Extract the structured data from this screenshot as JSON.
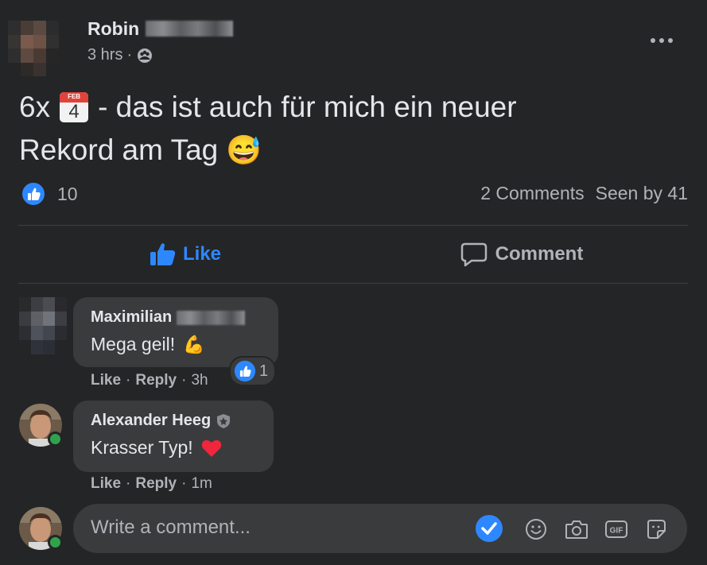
{
  "post": {
    "author_first": "Robin",
    "time": "3 hrs",
    "privacy_sep": "·",
    "text_line1_prefix": "6x",
    "calendar_month": "FEB",
    "calendar_day": "4",
    "text_line1_suffix": "- das ist auch für mich ein neuer",
    "text_line2": "Rekord am Tag",
    "emoji": "😅",
    "reaction_count": "10",
    "comments_count": "2 Comments",
    "seen_by": "Seen by 41"
  },
  "actions": {
    "like_label": "Like",
    "comment_label": "Comment"
  },
  "comments": [
    {
      "author": "Maximilian",
      "text": "Mega geil!",
      "emoji": "💪",
      "like": "Like",
      "reply": "Reply",
      "time": "3h",
      "reaction_count": "1"
    },
    {
      "author": "Alexander Heeg",
      "text": "Krasser Typ!",
      "emoji": "❤️",
      "like": "Like",
      "reply": "Reply",
      "time": "1m"
    }
  ],
  "composer": {
    "placeholder": "Write a comment..."
  },
  "colors": {
    "background": "#242526",
    "bubble": "#3a3b3c",
    "accent_blue": "#2d88ff",
    "online_green": "#31a24c"
  },
  "icons": [
    "more-icon",
    "friends-privacy-icon",
    "like-reaction-icon",
    "like-thumb-icon",
    "comment-icon",
    "verified-check-icon",
    "emoji-icon",
    "camera-icon",
    "gif-icon",
    "sticker-icon",
    "shield-badge-icon"
  ]
}
